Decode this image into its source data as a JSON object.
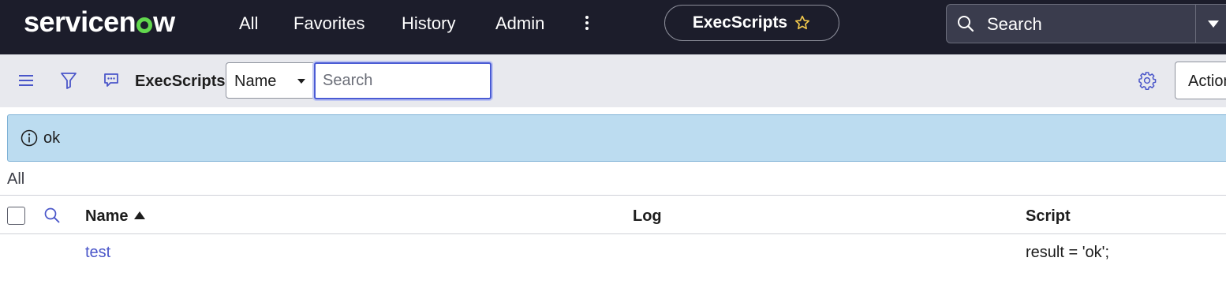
{
  "brand": {
    "logo_text_before": "servicen",
    "logo_text_after": "w",
    "logo_accent_color": "#62d84e"
  },
  "topnav": {
    "items": [
      {
        "label": "All"
      },
      {
        "label": "Favorites"
      },
      {
        "label": "History"
      },
      {
        "label": "Admin"
      }
    ],
    "more_icon": "more-vertical-icon",
    "context_title": "ExecScripts",
    "favorite_icon": "star-outline-icon",
    "search_placeholder": "Search",
    "background_color": "#1c1d2b"
  },
  "toolbar": {
    "menu_icon": "hamburger-icon",
    "filter_icon": "funnel-icon",
    "comment_icon": "chat-icon",
    "list_title": "ExecScripts",
    "field_select_value": "Name",
    "search_placeholder": "Search",
    "settings_icon": "gear-icon",
    "actions_label": "Actions on selected rows..."
  },
  "message": {
    "icon": "info-icon",
    "text": "ok",
    "color": "#bcdcf0"
  },
  "breadcrumb": {
    "label": "All"
  },
  "table": {
    "columns": [
      {
        "label": "Name",
        "sorted": "ascending"
      },
      {
        "label": "Log"
      },
      {
        "label": "Script"
      }
    ],
    "rows": [
      {
        "name": "test",
        "log": "",
        "script": "result = 'ok';"
      }
    ],
    "link_color": "#4a56c9"
  }
}
